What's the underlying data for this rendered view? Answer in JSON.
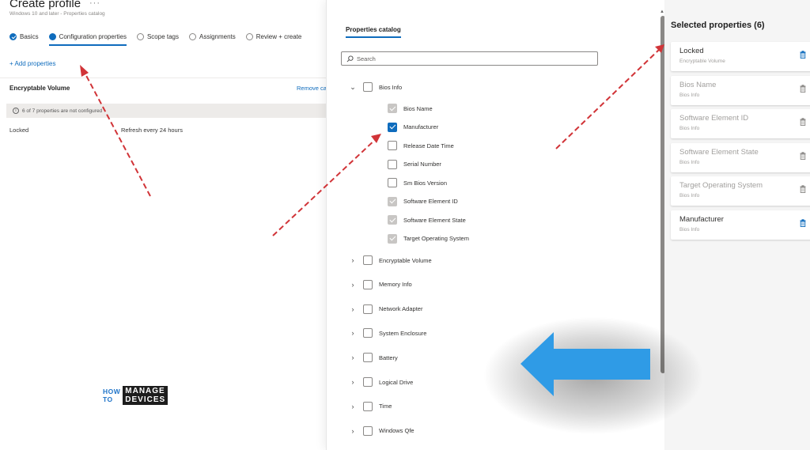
{
  "header": {
    "title": "Create profile",
    "more": "···",
    "subtitle": "Windows 10 and later - Properties catalog"
  },
  "steps": [
    {
      "label": "Basics",
      "state": "done"
    },
    {
      "label": "Configuration properties",
      "state": "active"
    },
    {
      "label": "Scope tags",
      "state": "todo"
    },
    {
      "label": "Assignments",
      "state": "todo"
    },
    {
      "label": "Review + create",
      "state": "todo"
    }
  ],
  "left": {
    "add_properties": "+ Add properties",
    "group_title": "Encryptable Volume",
    "remove": "Remove ca",
    "info": "6 of 7 properties are not configured",
    "prop_name": "Locked",
    "prop_value": "Refresh every 24 hours"
  },
  "logo": {
    "how": "HOW",
    "to": "TO",
    "manage": "MANAGE",
    "devices": "DEVICES"
  },
  "catalog": {
    "tab": "Properties catalog",
    "search_placeholder": "Search",
    "root": {
      "label": "Bios Info",
      "expanded": true,
      "checked": false
    },
    "children": [
      {
        "label": "Bios Name",
        "state": "disabled"
      },
      {
        "label": "Manufacturer",
        "state": "checked"
      },
      {
        "label": "Release Date Time",
        "state": "unchecked"
      },
      {
        "label": "Serial Number",
        "state": "unchecked"
      },
      {
        "label": "Sm Bios Version",
        "state": "unchecked"
      },
      {
        "label": "Software Element ID",
        "state": "disabled"
      },
      {
        "label": "Software Element State",
        "state": "disabled"
      },
      {
        "label": "Target Operating System",
        "state": "disabled"
      }
    ],
    "groups": [
      "Encryptable Volume",
      "Memory Info",
      "Network Adapter",
      "System Enclosure",
      "Battery",
      "Logical Drive",
      "Time",
      "Windows Qfe"
    ]
  },
  "selected": {
    "title": "Selected properties (6)",
    "items": [
      {
        "name": "Locked",
        "sub": "Encryptable Volume",
        "active": true
      },
      {
        "name": "Bios Name",
        "sub": "Bios Info",
        "active": false
      },
      {
        "name": "Software Element ID",
        "sub": "Bios Info",
        "active": false
      },
      {
        "name": "Software Element State",
        "sub": "Bios Info",
        "active": false
      },
      {
        "name": "Target Operating System",
        "sub": "Bios Info",
        "active": false
      },
      {
        "name": "Manufacturer",
        "sub": "Bios Info",
        "active": true
      }
    ]
  },
  "colors": {
    "accent": "#0f6cbd",
    "annotation_arrow": "#d13438",
    "highlight_arrow": "#2f9be6"
  }
}
